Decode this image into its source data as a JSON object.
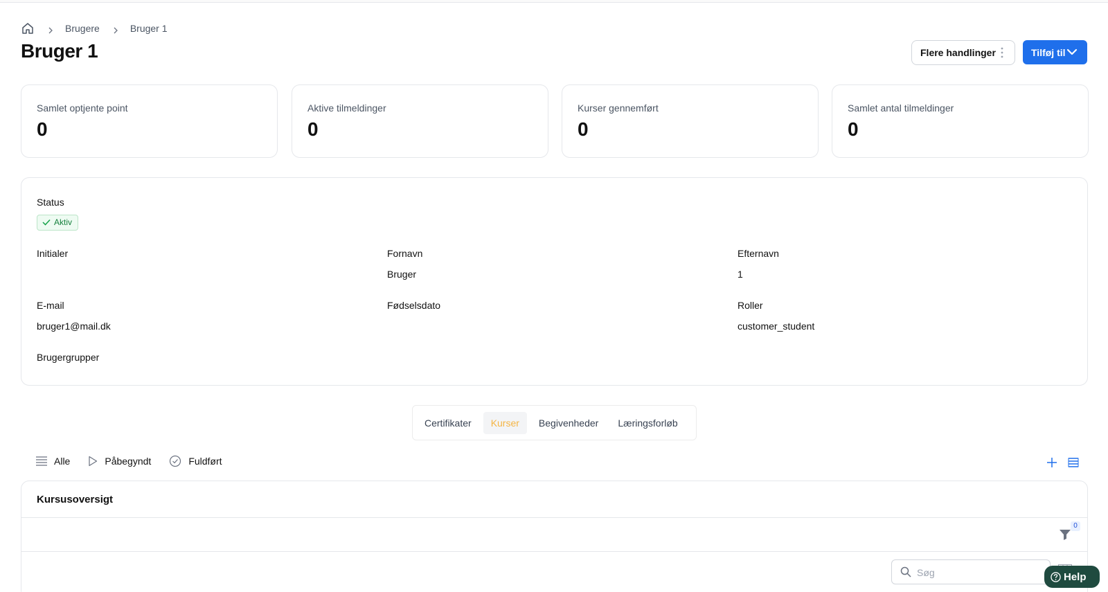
{
  "breadcrumb": {
    "items": [
      "Brugere",
      "Bruger 1"
    ]
  },
  "page": {
    "title": "Bruger 1"
  },
  "header_actions": {
    "more_label": "Flere handlinger",
    "add_label": "Tilføj til"
  },
  "stats": [
    {
      "label": "Samlet optjente point",
      "value": "0"
    },
    {
      "label": "Aktive tilmeldinger",
      "value": "0"
    },
    {
      "label": "Kurser gennemført",
      "value": "0"
    },
    {
      "label": "Samlet antal tilmeldinger",
      "value": "0"
    }
  ],
  "details": {
    "status_label": "Status",
    "status_value": "Aktiv",
    "status_color": "#15803d",
    "initials_label": "Initialer",
    "initials_value": "",
    "firstname_label": "Fornavn",
    "firstname_value": "Bruger",
    "lastname_label": "Efternavn",
    "lastname_value": "1",
    "email_label": "E-mail",
    "email_value": "bruger1@mail.dk",
    "birthdate_label": "Fødselsdato",
    "birthdate_value": "",
    "roles_label": "Roller",
    "roles_value": "customer_student",
    "groups_label": "Brugergrupper",
    "groups_value": ""
  },
  "tabs": [
    {
      "label": "Certifikater",
      "active": false
    },
    {
      "label": "Kurser",
      "active": true
    },
    {
      "label": "Begivenheder",
      "active": false
    },
    {
      "label": "Læringsforløb",
      "active": false
    }
  ],
  "tab_active_color": "#f5b544",
  "filters": {
    "all_label": "Alle",
    "started_label": "Påbegyndt",
    "completed_label": "Fuldført"
  },
  "course_overview": {
    "title": "Kursusoversigt",
    "filter_count": "0",
    "search_placeholder": "Søg",
    "search_value": ""
  },
  "help": {
    "label": "Help"
  },
  "colors": {
    "primary": "#1f6feb",
    "help_bg": "#1f4a3f"
  }
}
